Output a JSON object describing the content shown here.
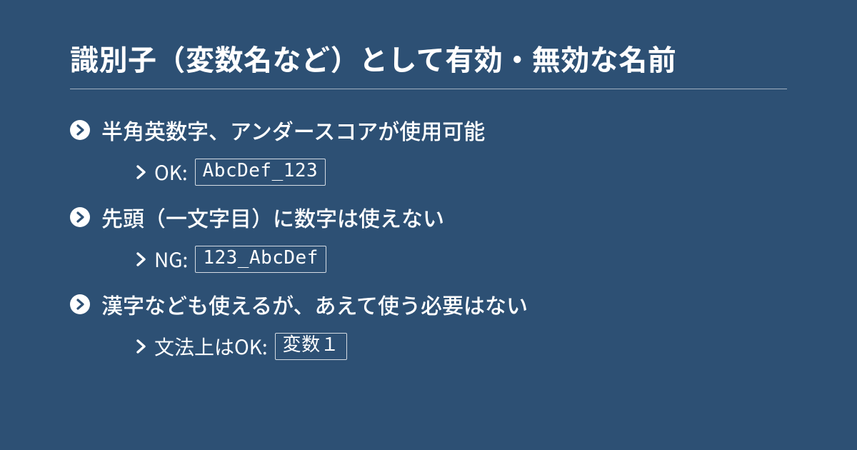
{
  "title": "識別子（変数名など）として有効・無効な名前",
  "items": [
    {
      "text": "半角英数字、アンダースコアが使用可能",
      "sub": {
        "label": "OK:",
        "code": "AbcDef_123"
      }
    },
    {
      "text": "先頭（一文字目）に数字は使えない",
      "sub": {
        "label": "NG:",
        "code": "123_AbcDef"
      }
    },
    {
      "text": "漢字なども使えるが、あえて使う必要はない",
      "sub": {
        "label": "文法上はOK:",
        "code": "変数１"
      }
    }
  ]
}
